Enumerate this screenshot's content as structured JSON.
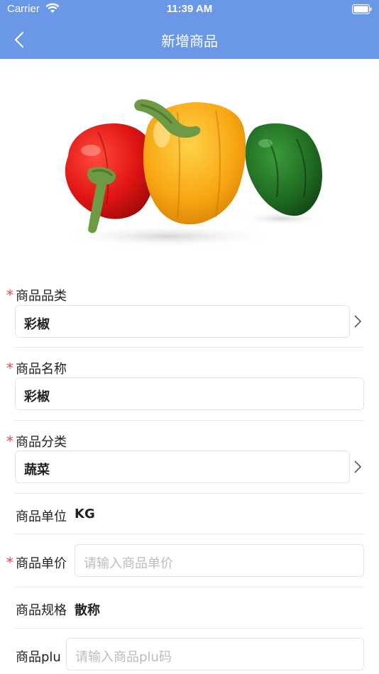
{
  "status_bar": {
    "carrier": "Carrier",
    "time": "11:39 AM"
  },
  "nav": {
    "title": "新增商品"
  },
  "product_image": {
    "description_icon": "bell-peppers-image"
  },
  "form": {
    "category": {
      "required": "*",
      "label": "商品品类",
      "value": "彩椒"
    },
    "name": {
      "required": "*",
      "label": "商品名称",
      "value": "彩椒"
    },
    "classification": {
      "required": "*",
      "label": "商品分类",
      "value": "蔬菜"
    },
    "unit": {
      "label": "商品单位",
      "value": "KG"
    },
    "price": {
      "required": "*",
      "label": "商品单价",
      "placeholder": "请输入商品单价"
    },
    "spec": {
      "label": "商品规格",
      "value": "散称"
    },
    "plu": {
      "label": "商品plu",
      "placeholder": "请输入商品plu码"
    }
  },
  "colors": {
    "brand": "#6a98e6",
    "required": "#e54d4d"
  }
}
